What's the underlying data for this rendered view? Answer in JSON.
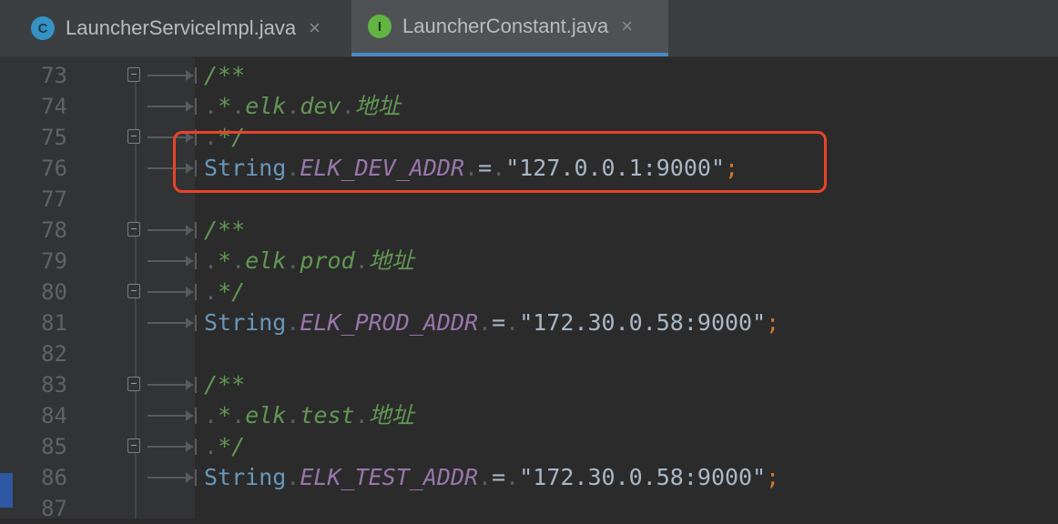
{
  "tabs": [
    {
      "icon_letter": "C",
      "icon_name": "class-icon",
      "label": "LauncherServiceImpl.java",
      "close": "×",
      "active": false
    },
    {
      "icon_letter": "I",
      "icon_name": "interface-icon",
      "label": "LauncherConstant.java",
      "close": "×",
      "active": true
    }
  ],
  "colors": {
    "background": "#2b2b2b",
    "comment": "#629755",
    "keyword_type": "#6897bb",
    "constant": "#9876aa",
    "string": "#a9b7c6",
    "semicolon": "#cc7832",
    "highlight_box": "#e8442a",
    "active_tab_underline": "#4a88c7"
  },
  "lines": [
    {
      "num": "73",
      "doc_open": "/**"
    },
    {
      "num": "74",
      "doc_star": "*",
      "doc_a": "elk",
      "doc_b": "dev",
      "doc_c": "地址"
    },
    {
      "num": "75",
      "doc_close": "*/"
    },
    {
      "num": "76",
      "type": "String",
      "name": "ELK_DEV_ADDR",
      "eq": "=",
      "value": "\"127.0.0.1:9000\"",
      "semi": ";"
    },
    {
      "num": "77"
    },
    {
      "num": "78",
      "doc_open": "/**"
    },
    {
      "num": "79",
      "doc_star": "*",
      "doc_a": "elk",
      "doc_b": "prod",
      "doc_c": "地址"
    },
    {
      "num": "80",
      "doc_close": "*/"
    },
    {
      "num": "81",
      "type": "String",
      "name": "ELK_PROD_ADDR",
      "eq": "=",
      "value": "\"172.30.0.58:9000\"",
      "semi": ";"
    },
    {
      "num": "82"
    },
    {
      "num": "83",
      "doc_open": "/**"
    },
    {
      "num": "84",
      "doc_star": "*",
      "doc_a": "elk",
      "doc_b": "test",
      "doc_c": "地址"
    },
    {
      "num": "85",
      "doc_close": "*/"
    },
    {
      "num": "86",
      "type": "String",
      "name": "ELK_TEST_ADDR",
      "eq": "=",
      "value": "\"172.30.0.58:9000\"",
      "semi": ";"
    },
    {
      "num": "87"
    }
  ]
}
